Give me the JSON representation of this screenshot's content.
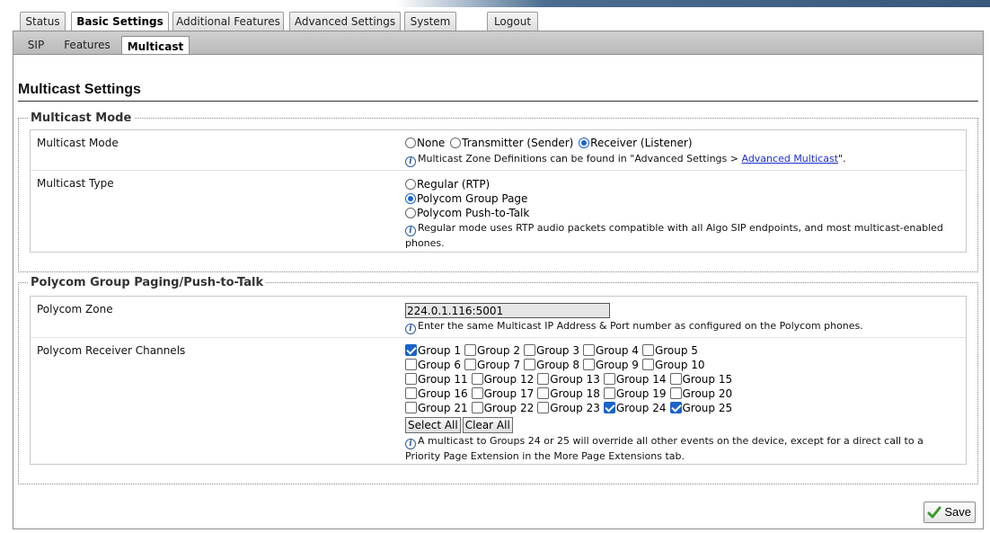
{
  "main_tabs": [
    {
      "label": "Status",
      "active": false
    },
    {
      "label": "Basic Settings",
      "active": true
    },
    {
      "label": "Additional Features",
      "active": false
    },
    {
      "label": "Advanced Settings",
      "active": false
    },
    {
      "label": "System",
      "active": false
    },
    {
      "label": "Logout",
      "active": false
    }
  ],
  "sub_tabs": [
    {
      "label": "SIP",
      "active": false
    },
    {
      "label": "Features",
      "active": false
    },
    {
      "label": "Multicast",
      "active": true
    }
  ],
  "page_title": "Multicast Settings",
  "multicast_section": {
    "legend": "Multicast Mode",
    "mode": {
      "label": "Multicast Mode",
      "options": [
        "None",
        "Transmitter (Sender)",
        "Receiver (Listener)"
      ],
      "selected": "Receiver (Listener)",
      "hint_prefix": "Multicast Zone Definitions can be found in \"Advanced Settings > ",
      "hint_link": "Advanced Multicast",
      "hint_suffix": "\"."
    },
    "type": {
      "label": "Multicast Type",
      "options": [
        "Regular (RTP)",
        "Polycom Group Page",
        "Polycom Push-to-Talk"
      ],
      "selected": "Polycom Group Page",
      "hint": "Regular mode uses RTP audio packets compatible with all Algo SIP endpoints, and most multicast-enabled phones."
    }
  },
  "polycom_section": {
    "legend": "Polycom Group Paging/Push-to-Talk",
    "zone": {
      "label": "Polycom Zone",
      "value": "224.0.1.116:5001",
      "hint": "Enter the same Multicast IP Address & Port number as configured on the Polycom phones."
    },
    "channels": {
      "label": "Polycom Receiver Channels",
      "groups": [
        {
          "label": "Group 1",
          "checked": true
        },
        {
          "label": "Group 2",
          "checked": false
        },
        {
          "label": "Group 3",
          "checked": false
        },
        {
          "label": "Group 4",
          "checked": false
        },
        {
          "label": "Group 5",
          "checked": false
        },
        {
          "label": "Group 6",
          "checked": false
        },
        {
          "label": "Group 7",
          "checked": false
        },
        {
          "label": "Group 8",
          "checked": false
        },
        {
          "label": "Group 9",
          "checked": false
        },
        {
          "label": "Group 10",
          "checked": false
        },
        {
          "label": "Group 11",
          "checked": false
        },
        {
          "label": "Group 12",
          "checked": false
        },
        {
          "label": "Group 13",
          "checked": false
        },
        {
          "label": "Group 14",
          "checked": false
        },
        {
          "label": "Group 15",
          "checked": false
        },
        {
          "label": "Group 16",
          "checked": false
        },
        {
          "label": "Group 17",
          "checked": false
        },
        {
          "label": "Group 18",
          "checked": false
        },
        {
          "label": "Group 19",
          "checked": false
        },
        {
          "label": "Group 20",
          "checked": false
        },
        {
          "label": "Group 21",
          "checked": false
        },
        {
          "label": "Group 22",
          "checked": false
        },
        {
          "label": "Group 23",
          "checked": false
        },
        {
          "label": "Group 24",
          "checked": true
        },
        {
          "label": "Group 25",
          "checked": true
        }
      ],
      "select_all_label": "Select All",
      "clear_all_label": "Clear All",
      "hint": "A multicast to Groups 24 or 25 will override all other events on the device, except for a direct call to a Priority Page Extension in the More Page Extensions tab."
    }
  },
  "save_label": "Save",
  "colors": {
    "accent": "#1a63c9",
    "link": "#1a2fd0",
    "save_check": "#3a9a2a",
    "header_bar": "#39587a"
  }
}
